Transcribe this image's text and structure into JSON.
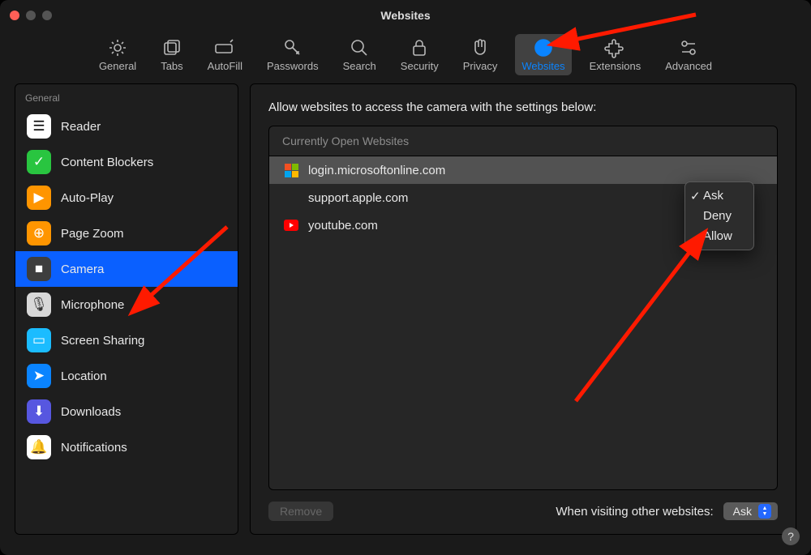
{
  "window": {
    "title": "Websites"
  },
  "toolbar": {
    "tabs": [
      {
        "label": "General",
        "icon": "gear-icon"
      },
      {
        "label": "Tabs",
        "icon": "tabs-icon"
      },
      {
        "label": "AutoFill",
        "icon": "autofill-icon"
      },
      {
        "label": "Passwords",
        "icon": "key-icon"
      },
      {
        "label": "Search",
        "icon": "search-icon"
      },
      {
        "label": "Security",
        "icon": "lock-icon"
      },
      {
        "label": "Privacy",
        "icon": "hand-icon"
      },
      {
        "label": "Websites",
        "icon": "globe-icon",
        "active": true
      },
      {
        "label": "Extensions",
        "icon": "puzzle-icon"
      },
      {
        "label": "Advanced",
        "icon": "advanced-icon"
      }
    ]
  },
  "sidebar": {
    "group_label": "General",
    "items": [
      {
        "label": "Reader",
        "icon": "reader-icon"
      },
      {
        "label": "Content Blockers",
        "icon": "shield-check-icon"
      },
      {
        "label": "Auto-Play",
        "icon": "play-icon"
      },
      {
        "label": "Page Zoom",
        "icon": "zoom-icon"
      },
      {
        "label": "Camera",
        "icon": "camera-icon",
        "selected": true
      },
      {
        "label": "Microphone",
        "icon": "microphone-icon"
      },
      {
        "label": "Screen Sharing",
        "icon": "screen-icon"
      },
      {
        "label": "Location",
        "icon": "location-icon"
      },
      {
        "label": "Downloads",
        "icon": "download-icon"
      },
      {
        "label": "Notifications",
        "icon": "bell-icon"
      }
    ]
  },
  "main": {
    "heading": "Allow websites to access the camera with the settings below:",
    "sites_header": "Currently Open Websites",
    "sites": [
      {
        "domain": "login.microsoftonline.com",
        "icon": "microsoft-icon",
        "selected": true
      },
      {
        "domain": "support.apple.com",
        "icon": "apple-icon"
      },
      {
        "domain": "youtube.com",
        "icon": "youtube-icon"
      }
    ],
    "remove_label": "Remove",
    "visiting_other_label": "When visiting other websites:",
    "visiting_other_value": "Ask"
  },
  "popover": {
    "options": [
      "Ask",
      "Deny",
      "Allow"
    ],
    "checked": "Ask"
  },
  "help": {
    "label": "?"
  },
  "annotation_arrows": {
    "note": "red instructional arrows overlaid on screenshot",
    "count": 3
  }
}
